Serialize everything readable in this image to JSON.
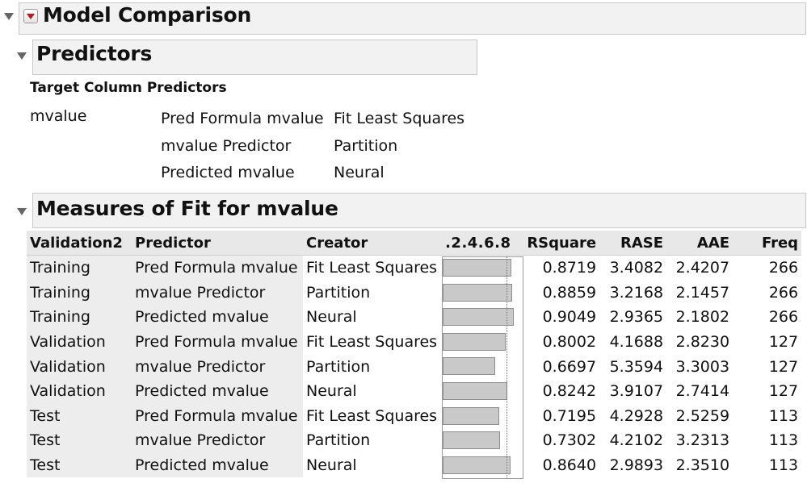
{
  "report": {
    "title": "Model Comparison",
    "predictors": {
      "title": "Predictors",
      "subtitle": "Target Column Predictors",
      "target": "mvalue",
      "rows": [
        {
          "predictor": "Pred Formula mvalue",
          "creator": "Fit Least Squares"
        },
        {
          "predictor": "mvalue Predictor",
          "creator": "Partition"
        },
        {
          "predictor": "Predicted mvalue",
          "creator": "Neural"
        }
      ]
    },
    "measures": {
      "title": "Measures of Fit for mvalue",
      "columns": [
        "Validation2",
        "Predictor",
        "Creator",
        ".2.4.6.8",
        "RSquare",
        "RASE",
        "AAE",
        "Freq"
      ],
      "rows": [
        [
          "Training",
          "Pred Formula mvalue",
          "Fit Least Squares",
          "",
          "0.8719",
          "3.4082",
          "2.4207",
          "266"
        ],
        [
          "Training",
          "mvalue Predictor",
          "Partition",
          "",
          "0.8859",
          "3.2168",
          "2.1457",
          "266"
        ],
        [
          "Training",
          "Predicted mvalue",
          "Neural",
          "",
          "0.9049",
          "2.9365",
          "2.1802",
          "266"
        ],
        [
          "Validation",
          "Pred Formula mvalue",
          "Fit Least Squares",
          "",
          "0.8002",
          "4.1688",
          "2.8230",
          "127"
        ],
        [
          "Validation",
          "mvalue Predictor",
          "Partition",
          "",
          "0.6697",
          "5.3594",
          "3.3003",
          "127"
        ],
        [
          "Validation",
          "Predicted mvalue",
          "Neural",
          "",
          "0.8242",
          "3.9107",
          "2.7414",
          "127"
        ],
        [
          "Test",
          "Pred Formula mvalue",
          "Fit Least Squares",
          "",
          "0.7195",
          "4.2928",
          "2.5259",
          "113"
        ],
        [
          "Test",
          "mvalue Predictor",
          "Partition",
          "",
          "0.7302",
          "4.2102",
          "3.2313",
          "113"
        ],
        [
          "Test",
          "Predicted mvalue",
          "Neural",
          "",
          "0.8640",
          "2.9893",
          "2.3510",
          "113"
        ]
      ],
      "rsquare_values": [
        0.8719,
        0.8859,
        0.9049,
        0.8002,
        0.6697,
        0.8242,
        0.7195,
        0.7302,
        0.864
      ]
    }
  },
  "colors": {
    "header_bg": "#f2f2f2",
    "shade": "#ededed",
    "bar": "#c9c9c9",
    "menu_arrow": "#c0151b"
  }
}
